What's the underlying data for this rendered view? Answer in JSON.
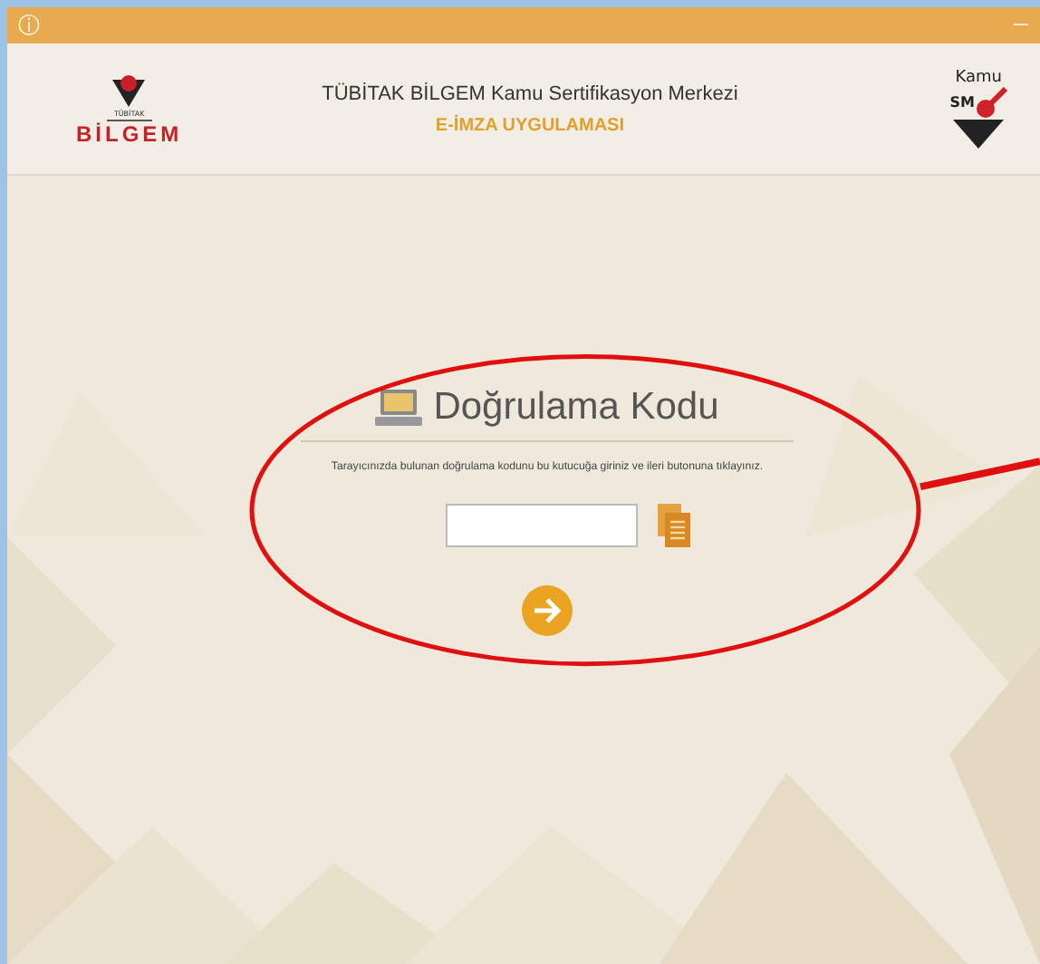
{
  "titlebar": {
    "info_icon": "ⓘ",
    "minimize": "—"
  },
  "header": {
    "left_logo": {
      "small_text": "TÜBİTAK",
      "text": "BİLGEM"
    },
    "title": "TÜBİTAK BİLGEM Kamu Sertifikasyon Merkezi",
    "subtitle": "E-İMZA UYGULAMASI",
    "right_logo": {
      "line_1": "Kamu",
      "line_2": "SM"
    }
  },
  "verification": {
    "heading": "Doğrulama Kodu",
    "instruction": "Tarayıcınızda bulunan doğrulama kodunu bu kutucuğa giriniz ve ileri butonuna tıklayınız."
  },
  "annotation": {
    "ellipse": true,
    "arrow": true
  }
}
